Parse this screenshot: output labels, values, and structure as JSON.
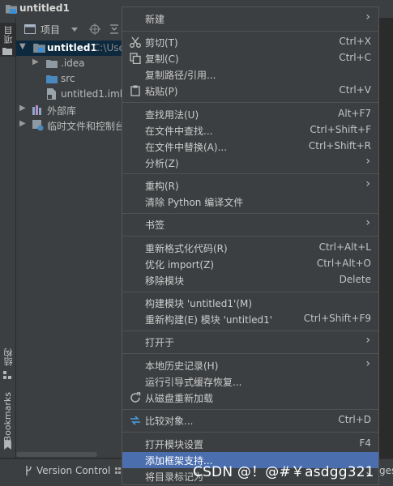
{
  "window": {
    "title": "untitled1"
  },
  "left_strip": {
    "project_tab": "项目",
    "structure_tab": "结构",
    "bookmarks_tab": "Bookmarks"
  },
  "project_toolbar": {
    "view_label": "项目"
  },
  "tree": {
    "root_name": "untitled1",
    "root_path": "C:\\Use",
    "items": [
      {
        "label": ".idea"
      },
      {
        "label": "src"
      },
      {
        "label": "untitled1.iml"
      },
      {
        "label": "外部库"
      },
      {
        "label": "临时文件和控制台"
      }
    ]
  },
  "bottom_bar": {
    "version_control": "Version Control",
    "right_cut": "ges"
  },
  "menu": {
    "items": [
      {
        "label": "新建",
        "shortcut": "",
        "submenu": true
      },
      {
        "label": "剪切(T)",
        "shortcut": "Ctrl+X",
        "icon": "cut-icon"
      },
      {
        "label": "复制(C)",
        "shortcut": "Ctrl+C",
        "icon": "copy-icon"
      },
      {
        "label": "复制路径/引用...",
        "shortcut": ""
      },
      {
        "label": "粘贴(P)",
        "shortcut": "Ctrl+V",
        "icon": "paste-icon"
      },
      {
        "label": "查找用法(U)",
        "shortcut": "Alt+F7"
      },
      {
        "label": "在文件中查找...",
        "shortcut": "Ctrl+Shift+F"
      },
      {
        "label": "在文件中替换(A)...",
        "shortcut": "Ctrl+Shift+R"
      },
      {
        "label": "分析(Z)",
        "shortcut": "",
        "submenu": true
      },
      {
        "label": "重构(R)",
        "shortcut": "",
        "submenu": true
      },
      {
        "label": "清除 Python 编译文件",
        "shortcut": ""
      },
      {
        "label": "书签",
        "shortcut": "",
        "submenu": true
      },
      {
        "label": "重新格式化代码(R)",
        "shortcut": "Ctrl+Alt+L"
      },
      {
        "label": "优化 import(Z)",
        "shortcut": "Ctrl+Alt+O"
      },
      {
        "label": "移除模块",
        "shortcut": "Delete"
      },
      {
        "label": "构建模块 'untitled1'(M)",
        "shortcut": ""
      },
      {
        "label": "重新构建(E) 模块 'untitled1'",
        "shortcut": "Ctrl+Shift+F9"
      },
      {
        "label": "打开于",
        "shortcut": "",
        "submenu": true
      },
      {
        "label": "本地历史记录(H)",
        "shortcut": "",
        "submenu": true
      },
      {
        "label": "运行引导式缓存恢复...",
        "shortcut": ""
      },
      {
        "label": "从磁盘重新加载",
        "shortcut": "",
        "icon": "reload-icon"
      },
      {
        "label": "比较对象...",
        "shortcut": "Ctrl+D",
        "icon": "compare-icon"
      },
      {
        "label": "打开模块设置",
        "shortcut": "F4"
      },
      {
        "label": "添加框架支持...",
        "shortcut": "",
        "highlighted": true
      },
      {
        "label": "将目录标记为",
        "shortcut": "",
        "submenu": true
      }
    ],
    "submenu_glyph": "›"
  },
  "watermark": "CSDN @！@#￥asdgg321",
  "colors": {
    "menu_bg": "#3c3f41",
    "highlight": "#4b6eaf",
    "selected_row": "#0d293e"
  }
}
